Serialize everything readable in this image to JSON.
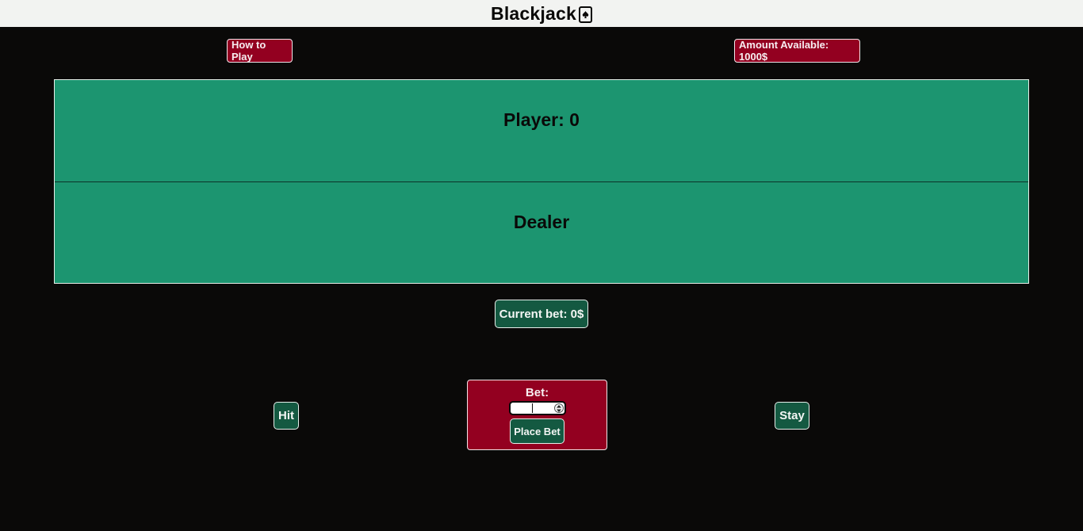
{
  "header": {
    "title": "Blackjack",
    "icon": "spade-card-icon"
  },
  "controls": {
    "how_to_play_label": "How to Play",
    "amount_available": "Amount Available: 1000$"
  },
  "table": {
    "player_label": "Player: 0",
    "dealer_label": "Dealer"
  },
  "status": {
    "current_bet": "Current bet: 0$"
  },
  "actions": {
    "hit_label": "Hit",
    "stay_label": "Stay"
  },
  "bet_panel": {
    "label": "Bet:",
    "input_value": "",
    "place_bet_label": "Place Bet"
  },
  "colors": {
    "background": "#0a0908",
    "header_bg": "#f2f3f1",
    "table_green": "#1c9570",
    "button_red": "#930020",
    "button_green": "#145941"
  }
}
